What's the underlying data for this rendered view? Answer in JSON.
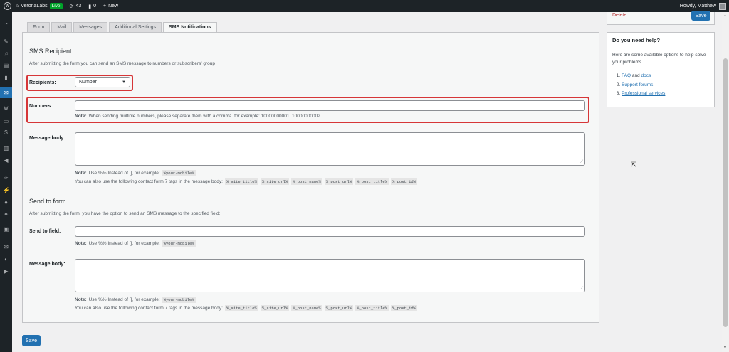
{
  "adminbar": {
    "site_name": "VeronaLabs",
    "live_badge": "Live",
    "updates_count": "43",
    "comments_count": "0",
    "new_label": "New",
    "howdy": "Howdy, Matthew"
  },
  "publish": {
    "delete_label": "Delete",
    "save_label": "Save"
  },
  "tabs": [
    {
      "label": "Form"
    },
    {
      "label": "Mail"
    },
    {
      "label": "Messages"
    },
    {
      "label": "Additional Settings"
    },
    {
      "label": "SMS Notifications"
    }
  ],
  "sms_recipient": {
    "title": "SMS Recipient",
    "description": "After submitting the form you can send an SMS message to numbers or subscribers' group",
    "recipients_label": "Recipients:",
    "recipients_value": "Number",
    "numbers_label": "Numbers:",
    "numbers_value": "",
    "numbers_note_prefix": "Note:",
    "numbers_note": "When sending multiple numbers, please separate them with a comma. for example: 10000000001, 10000000002.",
    "message_label": "Message body:",
    "message_value": "",
    "note_prefix": "Note:",
    "note_text": "Use %% Instead of [], for example:",
    "note_example": "%your-mobile%",
    "tags_text": "You can also use the following contact form 7 tags in the message body:",
    "tags": [
      "%_site_title%",
      "%_site_url%",
      "%_post_name%",
      "%_post_url%",
      "%_post_title%",
      "%_post_id%"
    ]
  },
  "send_to_form": {
    "title": "Send to form",
    "description": "After submitting the form, you have the option to send an SMS message to the specified field:",
    "field_label": "Send to field:",
    "field_value": "",
    "note_prefix": "Note:",
    "note_text": "Use %% Instead of [], for example:",
    "note_example": "%your-mobile%",
    "message_label": "Message body:",
    "message_value": "",
    "note2_prefix": "Note:",
    "note2_text": "Use %% Instead of [], for example:",
    "note2_example": "%your-mobile%",
    "tags_text": "You can also use the following contact form 7 tags in the message body:",
    "tags": [
      "%_site_title%",
      "%_site_url%",
      "%_post_name%",
      "%_post_url%",
      "%_post_title%",
      "%_post_id%"
    ]
  },
  "save_button": "Save",
  "help": {
    "title": "Do you need help?",
    "text": "Here are some available options to help solve your problems.",
    "item1_link_a": "FAQ",
    "item1_and": "and",
    "item1_link_b": "docs",
    "item2": "Support forums",
    "item3": "Professional services"
  },
  "colors": {
    "accent": "#2271b1",
    "highlight": "#d63638",
    "adminbar": "#1d2327"
  }
}
